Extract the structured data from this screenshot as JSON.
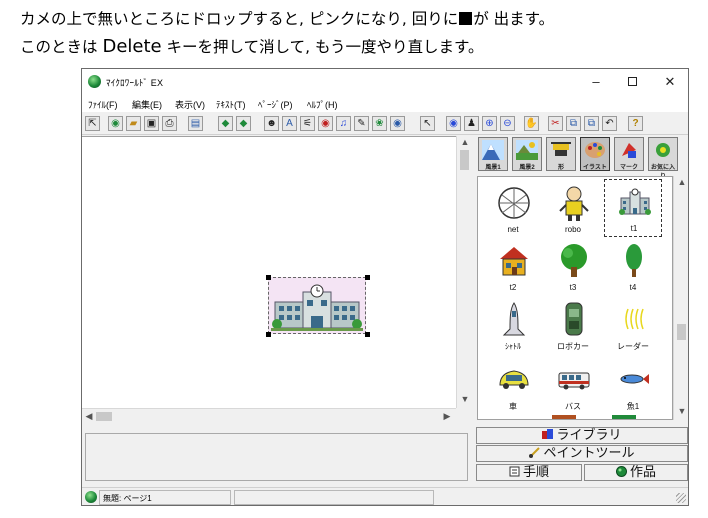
{
  "caption": {
    "line1_before": "カメの上で無いところにドロップすると, ピンクになり, 回りに",
    "line1_after": "が 出ます。",
    "line2_before": "このときは",
    "line2_key": "Delete",
    "line2_after": "キーを押して消して, もう一度やり直します。"
  },
  "window": {
    "title": "ﾏｲｸﾛﾜｰﾙﾄﾞ EX",
    "min": "–",
    "close": "✕"
  },
  "menu": [
    "ﾌｧｲﾙ(F)",
    "編集(E)",
    "表示(V)",
    "ﾃｷｽﾄ(T)",
    "ﾍﾟｰｼﾞ(P)",
    "ﾍﾙﾌﾟ(H)"
  ],
  "toolbar": {
    "glyphs": [
      "⇱",
      "◉",
      "▰",
      "▣",
      "⎙",
      "▤",
      "◆",
      "◆",
      "☻",
      "A",
      "⚟",
      "◉",
      "♫",
      "✎",
      "❀",
      "◉",
      "↖",
      "◉",
      "♟",
      "⊕",
      "⊖",
      "✋",
      "✂",
      "⧉",
      "⧉",
      "↶",
      "?"
    ]
  },
  "categories": [
    {
      "label": "風景1",
      "icon": "mountain-icon",
      "color": "#3a7fc8"
    },
    {
      "label": "風景2",
      "icon": "landscape-icon",
      "color": "#4a9a3a"
    },
    {
      "label": "形",
      "icon": "shape-icon",
      "color": "#c8a03a"
    },
    {
      "label": "イラスト",
      "icon": "palette-icon",
      "color": "#c85a3a"
    },
    {
      "label": "マーク",
      "icon": "mark-icon",
      "color": "#d0302a"
    },
    {
      "label": "お気に入り",
      "icon": "favorite-icon",
      "color": "#3aa03a"
    }
  ],
  "library_items": [
    {
      "label": "net",
      "icon": "net-ball-icon"
    },
    {
      "label": "robo",
      "icon": "robot-icon"
    },
    {
      "label": "t1",
      "icon": "school-icon",
      "selected": true
    },
    {
      "label": "t2",
      "icon": "house-icon"
    },
    {
      "label": "t3",
      "icon": "tree-icon"
    },
    {
      "label": "t4",
      "icon": "cypress-tree-icon"
    },
    {
      "label": "ｼｬﾄﾙ",
      "icon": "space-shuttle-icon"
    },
    {
      "label": "ロボカー",
      "icon": "robot-car-icon"
    },
    {
      "label": "レーダー",
      "icon": "radar-waves-icon"
    },
    {
      "label": "車",
      "icon": "car-icon"
    },
    {
      "label": "バス",
      "icon": "bus-icon"
    },
    {
      "label": "魚1",
      "icon": "fish-icon"
    }
  ],
  "panel_buttons": {
    "library": "ライブラリ",
    "paint_tool": "ペイントツール",
    "procedure": "手順",
    "works": "作品"
  },
  "status": {
    "text": "無題: ページ1"
  },
  "colors": {
    "selection_tint": "#f4e4f4",
    "window_bg": "#f0f0f0"
  }
}
